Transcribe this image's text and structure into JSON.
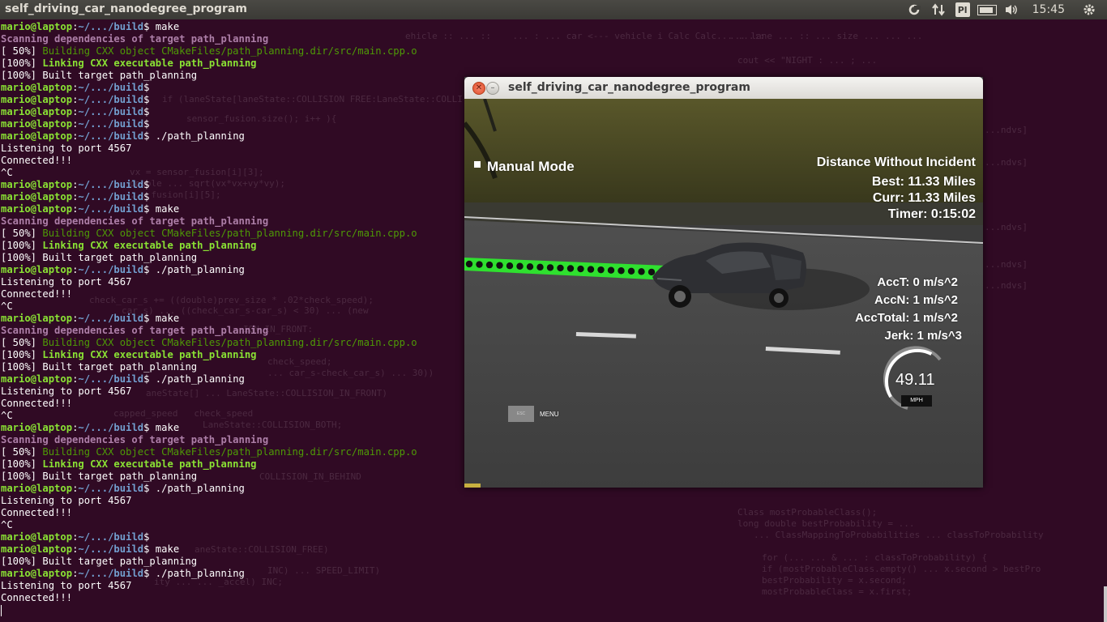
{
  "topbar": {
    "title": "self_driving_car_nanodegree_program",
    "lang": "Pl",
    "clock": "15:45"
  },
  "terminal": {
    "prompt_user": "mario@laptop",
    "prompt_path": "~/.../build",
    "lines": [
      {
        "t": "prompt",
        "cmd": " make"
      },
      {
        "t": "scan",
        "text": "Scanning dependencies of target path_planning"
      },
      {
        "t": "build",
        "text": "[ 50%] ",
        "rest": "Building CXX object CMakeFiles/path_planning.dir/src/main.cpp.o"
      },
      {
        "t": "link",
        "text": "[100%] ",
        "rest": "Linking CXX executable path_planning"
      },
      {
        "t": "plain",
        "text": "[100%] Built target path_planning"
      },
      {
        "t": "prompt",
        "cmd": ""
      },
      {
        "t": "prompt",
        "cmd": ""
      },
      {
        "t": "prompt",
        "cmd": ""
      },
      {
        "t": "prompt",
        "cmd": ""
      },
      {
        "t": "prompt",
        "cmd": " ./path_planning"
      },
      {
        "t": "plain",
        "text": "Listening to port 4567"
      },
      {
        "t": "plain",
        "text": "Connected!!!"
      },
      {
        "t": "plain",
        "text": "^C"
      },
      {
        "t": "prompt",
        "cmd": ""
      },
      {
        "t": "prompt",
        "cmd": ""
      },
      {
        "t": "prompt",
        "cmd": " make"
      },
      {
        "t": "scan",
        "text": "Scanning dependencies of target path_planning"
      },
      {
        "t": "build",
        "text": "[ 50%] ",
        "rest": "Building CXX object CMakeFiles/path_planning.dir/src/main.cpp.o"
      },
      {
        "t": "link",
        "text": "[100%] ",
        "rest": "Linking CXX executable path_planning"
      },
      {
        "t": "plain",
        "text": "[100%] Built target path_planning"
      },
      {
        "t": "prompt",
        "cmd": " ./path_planning"
      },
      {
        "t": "plain",
        "text": "Listening to port 4567"
      },
      {
        "t": "plain",
        "text": "Connected!!!"
      },
      {
        "t": "plain",
        "text": "^C"
      },
      {
        "t": "prompt",
        "cmd": " make"
      },
      {
        "t": "scan",
        "text": "Scanning dependencies of target path_planning"
      },
      {
        "t": "build",
        "text": "[ 50%] ",
        "rest": "Building CXX object CMakeFiles/path_planning.dir/src/main.cpp.o"
      },
      {
        "t": "link",
        "text": "[100%] ",
        "rest": "Linking CXX executable path_planning"
      },
      {
        "t": "plain",
        "text": "[100%] Built target path_planning"
      },
      {
        "t": "prompt",
        "cmd": " ./path_planning"
      },
      {
        "t": "plain",
        "text": "Listening to port 4567"
      },
      {
        "t": "plain",
        "text": "Connected!!!"
      },
      {
        "t": "plain",
        "text": "^C"
      },
      {
        "t": "prompt",
        "cmd": " make"
      },
      {
        "t": "scan",
        "text": "Scanning dependencies of target path_planning"
      },
      {
        "t": "build",
        "text": "[ 50%] ",
        "rest": "Building CXX object CMakeFiles/path_planning.dir/src/main.cpp.o"
      },
      {
        "t": "link",
        "text": "[100%] ",
        "rest": "Linking CXX executable path_planning"
      },
      {
        "t": "plain",
        "text": "[100%] Built target path_planning"
      },
      {
        "t": "prompt",
        "cmd": " ./path_planning"
      },
      {
        "t": "plain",
        "text": "Listening to port 4567"
      },
      {
        "t": "plain",
        "text": "Connected!!!"
      },
      {
        "t": "plain",
        "text": "^C"
      },
      {
        "t": "prompt",
        "cmd": ""
      },
      {
        "t": "prompt",
        "cmd": " make"
      },
      {
        "t": "plain",
        "text": "[100%] Built target path_planning"
      },
      {
        "t": "prompt",
        "cmd": " ./path_planning"
      },
      {
        "t": "plain",
        "text": "Listening to port 4567"
      },
      {
        "t": "plain",
        "text": "Connected!!!"
      }
    ]
  },
  "simulator": {
    "window_title": "self_driving_car_nanodegree_program",
    "mode": "Manual Mode",
    "distance_title": "Distance Without Incident",
    "best": "Best: 11.33 Miles",
    "curr": "Curr: 11.33 Miles",
    "timer": "Timer: 0:15:02",
    "acc_t": "AccT: 0 m/s^2",
    "acc_n": "AccN: 1 m/s^2",
    "acc_total": "AccTotal: 1 m/s^2",
    "jerk": "Jerk: 1 m/s^3",
    "speed": "49.11",
    "speed_unit": "MPH",
    "speed_fraction": 0.49,
    "esc_label": "ESC",
    "menu_label": "MENU"
  },
  "colors": {
    "terminal_bg": "#300a24",
    "prompt_user": "#8ae234",
    "prompt_path": "#729fcf",
    "path_dots": "#2fe02f"
  }
}
